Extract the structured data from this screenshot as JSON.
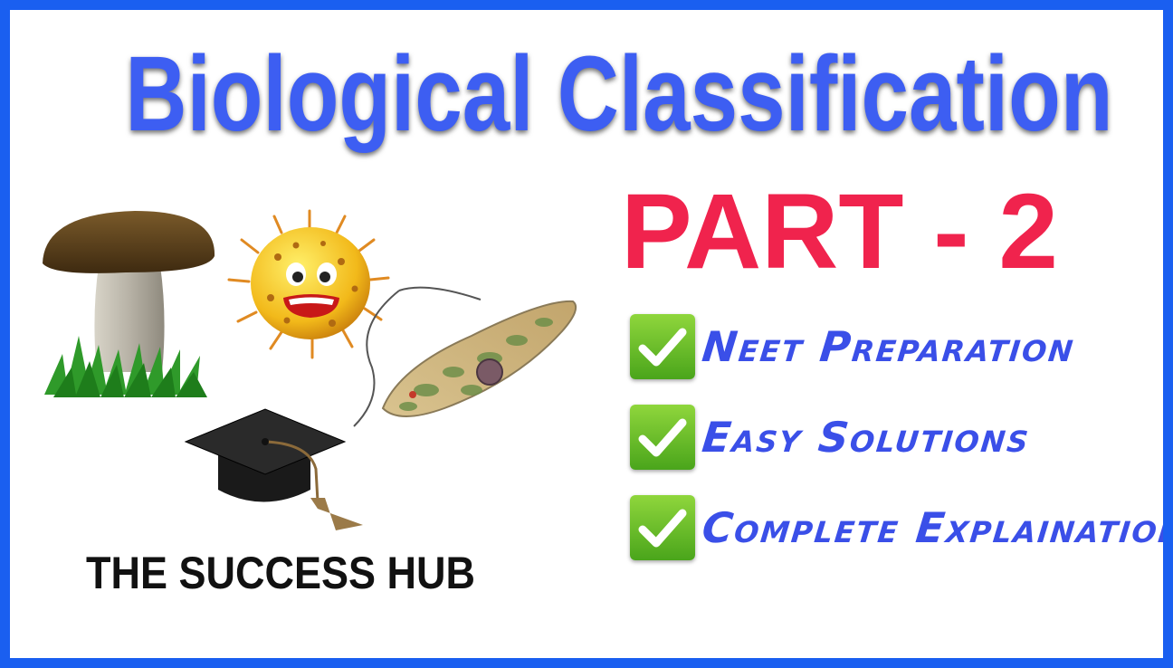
{
  "title": "Biological Classification",
  "subtitle": "PART - 2",
  "features": [
    {
      "label": "Neet Preparation",
      "icon": "check-mark-icon"
    },
    {
      "label": "Easy Solutions",
      "icon": "check-mark-icon"
    },
    {
      "label": "Complete Explaination",
      "icon": "check-mark-icon"
    }
  ],
  "brand": "THE SUCCESS HUB",
  "colors": {
    "frame": "#1a5ff0",
    "title": "#3d5ef2",
    "subtitle": "#f0234d",
    "features": "#3a4fe8",
    "check_bg": "#5cb82a"
  },
  "illustrations": [
    "mushroom-icon",
    "bacterium-icon",
    "euglena-icon",
    "graduation-cap-icon"
  ]
}
